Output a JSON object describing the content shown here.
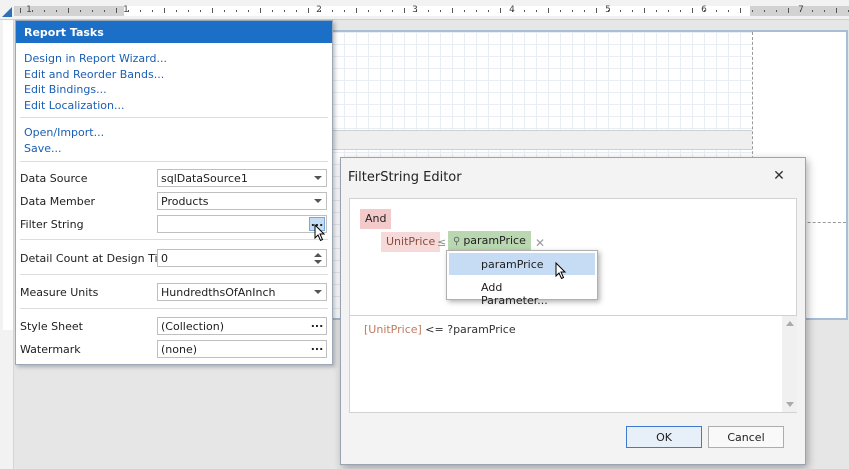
{
  "ruler": {
    "numbers": [
      "1",
      "1",
      "2",
      "3",
      "4",
      "5",
      "6",
      "7"
    ]
  },
  "report_tasks": {
    "title": "Report Tasks",
    "links": [
      "Design in Report Wizard...",
      "Edit and Reorder Bands...",
      "Edit Bindings...",
      "Edit Localization..."
    ],
    "file_links": [
      "Open/Import...",
      "Save..."
    ],
    "properties": {
      "data_source": {
        "label": "Data Source",
        "value": "sqlDataSource1"
      },
      "data_member": {
        "label": "Data Member",
        "value": "Products"
      },
      "filter_string": {
        "label": "Filter String",
        "value": ""
      },
      "detail_count": {
        "label": "Detail Count at Design Time",
        "value": "0"
      },
      "measure_units": {
        "label": "Measure Units",
        "value": "HundredthsOfAnInch"
      },
      "style_sheet": {
        "label": "Style Sheet",
        "value": "(Collection)"
      },
      "watermark": {
        "label": "Watermark",
        "value": "(none)"
      }
    },
    "ellipsis": "..."
  },
  "dialog": {
    "title": "FilterString Editor",
    "close": "✕",
    "group_operator": "And",
    "condition": {
      "field": "UnitPrice",
      "operator": "≤",
      "value": "paramPrice",
      "remove": "✕"
    },
    "popup_items": [
      "paramPrice",
      "Add Parameter..."
    ],
    "text_field": "[UnitPrice]",
    "text_rest": " <= ?paramPrice",
    "ok": "OK",
    "cancel": "Cancel"
  },
  "colors": {
    "accent": "#1c6fc7",
    "link": "#1a5fb4",
    "and_chip": "#f3c9c9",
    "param_chip": "#b9d7b0",
    "selected": "#c6dcf5"
  }
}
